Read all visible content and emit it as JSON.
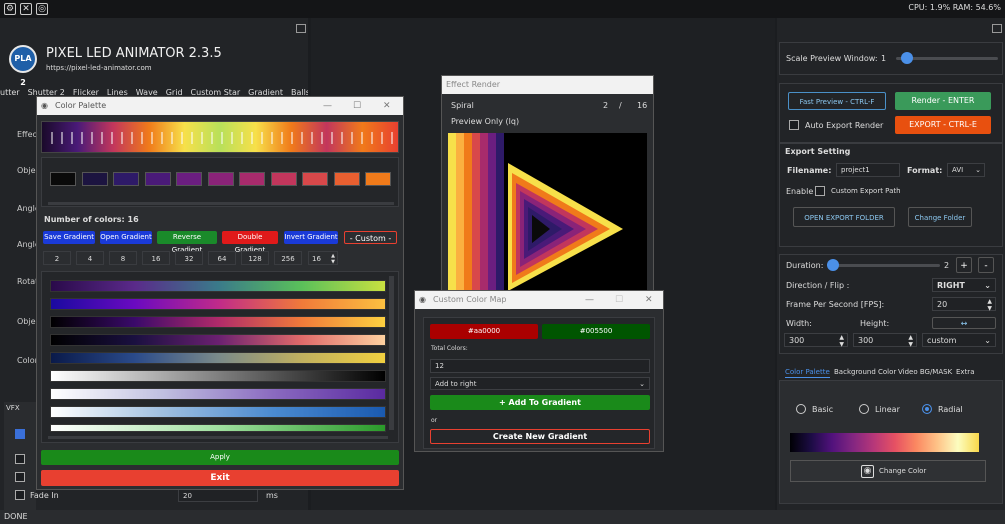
{
  "status": {
    "text": "DONE",
    "cpu_ram": "CPU: 1.9% RAM: 54.6%"
  },
  "topicons": [
    "gear-icon",
    "crossed-icon",
    "camera-icon"
  ],
  "app": {
    "title": "PIXEL LED ANIMATOR 2.3.5",
    "url": "https://pixel-led-animator.com",
    "logo": "PLA 2"
  },
  "menu": [
    "utter",
    "Shutter 2",
    "Flicker",
    "Lines",
    "Wave",
    "Grid",
    "Custom Star",
    "Gradient",
    "Balls"
  ],
  "sidelabels": [
    "Effec",
    "Obje",
    "Angle",
    "Angle",
    "Rotat",
    "Obje",
    "Color"
  ],
  "vfx": {
    "title": "VFX",
    "fade_label": "Fade In",
    "fade_value": "20",
    "fade_unit": "ms"
  },
  "palette": {
    "title": "Color Palette",
    "num_colors": "Number of colors: 16",
    "buttons": {
      "save": "Save Gradient",
      "open": "Open Gradient",
      "reverse": "Reverse Gradient",
      "double": "Double Gradient",
      "invert": "Invert Gradient",
      "custom": "- Custom -"
    },
    "counts": [
      "2",
      "4",
      "8",
      "16",
      "32",
      "64",
      "128",
      "256"
    ],
    "count_value": "16",
    "swatches": [
      "#0a0a0a",
      "#1c1440",
      "#2e1a68",
      "#4a1a78",
      "#6b1e80",
      "#8a2378",
      "#a82b6c",
      "#c2365c",
      "#d8484a",
      "#e85f30",
      "#f07a1a"
    ],
    "apply": "Apply",
    "exit": "Exit"
  },
  "effect": {
    "title": "Effect Render",
    "name": "Spiral",
    "page": "2",
    "sep": "/",
    "total": "16",
    "preview": "Preview Only (lq)"
  },
  "ccm": {
    "title": "Custom Color Map",
    "color1": "#aa0000",
    "color2": "#005500",
    "total_label": "Total Colors:",
    "total_value": "12",
    "mode": "Add to right",
    "add": "+ Add To Gradient",
    "or": "or",
    "create": "Create New Gradient"
  },
  "right": {
    "scale_label": "Scale Preview Window:",
    "scale_value": "1",
    "fast_preview": "Fast Preview - CTRL-F",
    "render": "Render - ENTER",
    "auto_export": "Auto Export Render",
    "export": "EXPORT - CTRL-E",
    "export_setting": "Export Setting",
    "filename_label": "Filename:",
    "filename": "project1",
    "format_label": "Format:",
    "format": "AVI",
    "enable": "Enable",
    "custom_path": "Custom Export Path",
    "open_folder": "OPEN EXPORT FOLDER",
    "change_folder": "Change Folder",
    "duration_label": "Duration:",
    "duration_value": "2",
    "plus": "+",
    "minus": "-",
    "direction_label": "Direction / Flip :",
    "direction": "RIGHT",
    "fps_label": "Frame Per Second [FPS]:",
    "fps": "20",
    "width_label": "Width:",
    "height_label": "Height:",
    "link": "↔",
    "width": "300",
    "height": "300",
    "size_mode": "custom",
    "tabs": [
      "Color Palette",
      "Background Color",
      "Video BG/MASK",
      "Extra"
    ],
    "radios": [
      "Basic",
      "Linear",
      "Radial"
    ],
    "change_color": "Change Color"
  }
}
